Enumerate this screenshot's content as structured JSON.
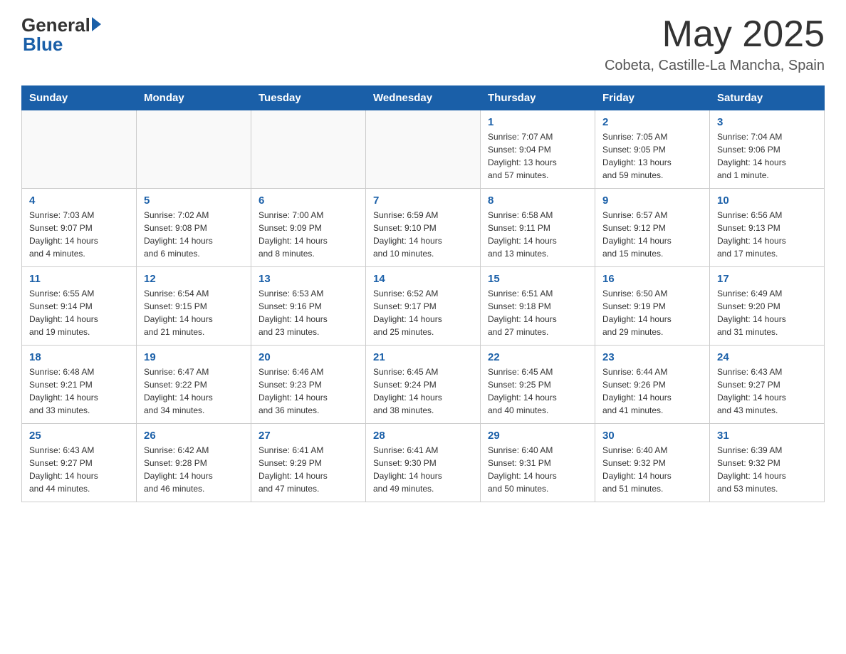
{
  "header": {
    "logo_general": "General",
    "logo_blue": "Blue",
    "month_year": "May 2025",
    "location": "Cobeta, Castille-La Mancha, Spain"
  },
  "days_of_week": [
    "Sunday",
    "Monday",
    "Tuesday",
    "Wednesday",
    "Thursday",
    "Friday",
    "Saturday"
  ],
  "weeks": [
    [
      {
        "day": "",
        "info": ""
      },
      {
        "day": "",
        "info": ""
      },
      {
        "day": "",
        "info": ""
      },
      {
        "day": "",
        "info": ""
      },
      {
        "day": "1",
        "info": "Sunrise: 7:07 AM\nSunset: 9:04 PM\nDaylight: 13 hours\nand 57 minutes."
      },
      {
        "day": "2",
        "info": "Sunrise: 7:05 AM\nSunset: 9:05 PM\nDaylight: 13 hours\nand 59 minutes."
      },
      {
        "day": "3",
        "info": "Sunrise: 7:04 AM\nSunset: 9:06 PM\nDaylight: 14 hours\nand 1 minute."
      }
    ],
    [
      {
        "day": "4",
        "info": "Sunrise: 7:03 AM\nSunset: 9:07 PM\nDaylight: 14 hours\nand 4 minutes."
      },
      {
        "day": "5",
        "info": "Sunrise: 7:02 AM\nSunset: 9:08 PM\nDaylight: 14 hours\nand 6 minutes."
      },
      {
        "day": "6",
        "info": "Sunrise: 7:00 AM\nSunset: 9:09 PM\nDaylight: 14 hours\nand 8 minutes."
      },
      {
        "day": "7",
        "info": "Sunrise: 6:59 AM\nSunset: 9:10 PM\nDaylight: 14 hours\nand 10 minutes."
      },
      {
        "day": "8",
        "info": "Sunrise: 6:58 AM\nSunset: 9:11 PM\nDaylight: 14 hours\nand 13 minutes."
      },
      {
        "day": "9",
        "info": "Sunrise: 6:57 AM\nSunset: 9:12 PM\nDaylight: 14 hours\nand 15 minutes."
      },
      {
        "day": "10",
        "info": "Sunrise: 6:56 AM\nSunset: 9:13 PM\nDaylight: 14 hours\nand 17 minutes."
      }
    ],
    [
      {
        "day": "11",
        "info": "Sunrise: 6:55 AM\nSunset: 9:14 PM\nDaylight: 14 hours\nand 19 minutes."
      },
      {
        "day": "12",
        "info": "Sunrise: 6:54 AM\nSunset: 9:15 PM\nDaylight: 14 hours\nand 21 minutes."
      },
      {
        "day": "13",
        "info": "Sunrise: 6:53 AM\nSunset: 9:16 PM\nDaylight: 14 hours\nand 23 minutes."
      },
      {
        "day": "14",
        "info": "Sunrise: 6:52 AM\nSunset: 9:17 PM\nDaylight: 14 hours\nand 25 minutes."
      },
      {
        "day": "15",
        "info": "Sunrise: 6:51 AM\nSunset: 9:18 PM\nDaylight: 14 hours\nand 27 minutes."
      },
      {
        "day": "16",
        "info": "Sunrise: 6:50 AM\nSunset: 9:19 PM\nDaylight: 14 hours\nand 29 minutes."
      },
      {
        "day": "17",
        "info": "Sunrise: 6:49 AM\nSunset: 9:20 PM\nDaylight: 14 hours\nand 31 minutes."
      }
    ],
    [
      {
        "day": "18",
        "info": "Sunrise: 6:48 AM\nSunset: 9:21 PM\nDaylight: 14 hours\nand 33 minutes."
      },
      {
        "day": "19",
        "info": "Sunrise: 6:47 AM\nSunset: 9:22 PM\nDaylight: 14 hours\nand 34 minutes."
      },
      {
        "day": "20",
        "info": "Sunrise: 6:46 AM\nSunset: 9:23 PM\nDaylight: 14 hours\nand 36 minutes."
      },
      {
        "day": "21",
        "info": "Sunrise: 6:45 AM\nSunset: 9:24 PM\nDaylight: 14 hours\nand 38 minutes."
      },
      {
        "day": "22",
        "info": "Sunrise: 6:45 AM\nSunset: 9:25 PM\nDaylight: 14 hours\nand 40 minutes."
      },
      {
        "day": "23",
        "info": "Sunrise: 6:44 AM\nSunset: 9:26 PM\nDaylight: 14 hours\nand 41 minutes."
      },
      {
        "day": "24",
        "info": "Sunrise: 6:43 AM\nSunset: 9:27 PM\nDaylight: 14 hours\nand 43 minutes."
      }
    ],
    [
      {
        "day": "25",
        "info": "Sunrise: 6:43 AM\nSunset: 9:27 PM\nDaylight: 14 hours\nand 44 minutes."
      },
      {
        "day": "26",
        "info": "Sunrise: 6:42 AM\nSunset: 9:28 PM\nDaylight: 14 hours\nand 46 minutes."
      },
      {
        "day": "27",
        "info": "Sunrise: 6:41 AM\nSunset: 9:29 PM\nDaylight: 14 hours\nand 47 minutes."
      },
      {
        "day": "28",
        "info": "Sunrise: 6:41 AM\nSunset: 9:30 PM\nDaylight: 14 hours\nand 49 minutes."
      },
      {
        "day": "29",
        "info": "Sunrise: 6:40 AM\nSunset: 9:31 PM\nDaylight: 14 hours\nand 50 minutes."
      },
      {
        "day": "30",
        "info": "Sunrise: 6:40 AM\nSunset: 9:32 PM\nDaylight: 14 hours\nand 51 minutes."
      },
      {
        "day": "31",
        "info": "Sunrise: 6:39 AM\nSunset: 9:32 PM\nDaylight: 14 hours\nand 53 minutes."
      }
    ]
  ]
}
